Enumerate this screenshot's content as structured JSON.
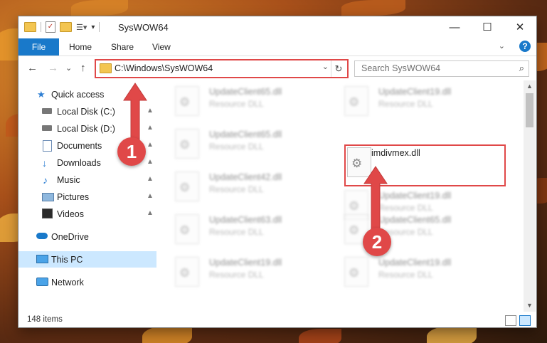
{
  "window": {
    "title": "SysWOW64",
    "minimize": "—",
    "maximize": "☐",
    "close": "✕"
  },
  "ribbon": {
    "tabs": [
      "File",
      "Home",
      "Share",
      "View"
    ],
    "expand": "⌄",
    "help": "?"
  },
  "nav": {
    "back": "←",
    "forward": "→",
    "recent": "⌄",
    "up": "↑",
    "address": "C:\\Windows\\SysWOW64",
    "dropdown": "⌄",
    "refresh": "↻",
    "search_placeholder": "Search SysWOW64",
    "search_icon": "⌕"
  },
  "sidebar": {
    "items": [
      {
        "label": "Quick access",
        "icon": "star-icon",
        "pinned": false
      },
      {
        "label": "Local Disk (C:)",
        "icon": "drive-icon",
        "pinned": true
      },
      {
        "label": "Local Disk (D:)",
        "icon": "drive-icon",
        "pinned": true
      },
      {
        "label": "Documents",
        "icon": "documents-icon",
        "pinned": true
      },
      {
        "label": "Downloads",
        "icon": "download-icon",
        "pinned": true
      },
      {
        "label": "Music",
        "icon": "music-icon",
        "pinned": true
      },
      {
        "label": "Pictures",
        "icon": "pictures-icon",
        "pinned": true
      },
      {
        "label": "Videos",
        "icon": "videos-icon",
        "pinned": true
      },
      {
        "label": "OneDrive",
        "icon": "cloud-icon",
        "pinned": false
      },
      {
        "label": "This PC",
        "icon": "computer-icon",
        "pinned": false,
        "selected": true
      },
      {
        "label": "Network",
        "icon": "network-icon",
        "pinned": false
      }
    ],
    "pin_glyph": "📌"
  },
  "files": {
    "left_column": [
      {
        "name": "UpdateClient65.dll",
        "type": "Resource DLL"
      },
      {
        "name": "UpdateClient65.dll",
        "type": "Resource DLL"
      },
      {
        "name": "UpdateClient42.dll",
        "type": "Resource DLL"
      },
      {
        "name": "UpdateClient63.dll",
        "type": "Resource DLL"
      },
      {
        "name": "UpdateClient19.dll",
        "type": "Resource DLL"
      }
    ],
    "right_column": [
      {
        "name": "UpdateClient19.dll",
        "type": "Resource DLL"
      },
      {
        "name": "imdivmex.dll",
        "type": ""
      },
      {
        "name": "UpdateClient19.dll",
        "type": "Resource DLL"
      },
      {
        "name": "UpdateClient65.dll",
        "type": "Resource DLL"
      },
      {
        "name": "UpdateClient19.dll",
        "type": "Resource DLL"
      }
    ],
    "highlighted": "imdivmex.dll"
  },
  "status": {
    "item_count": "148 items"
  },
  "annotations": {
    "step1": "1",
    "step2": "2",
    "color": "#e04848"
  },
  "colors": {
    "accent": "#1979ca",
    "selection": "#cce8ff",
    "highlight": "#e04848"
  }
}
